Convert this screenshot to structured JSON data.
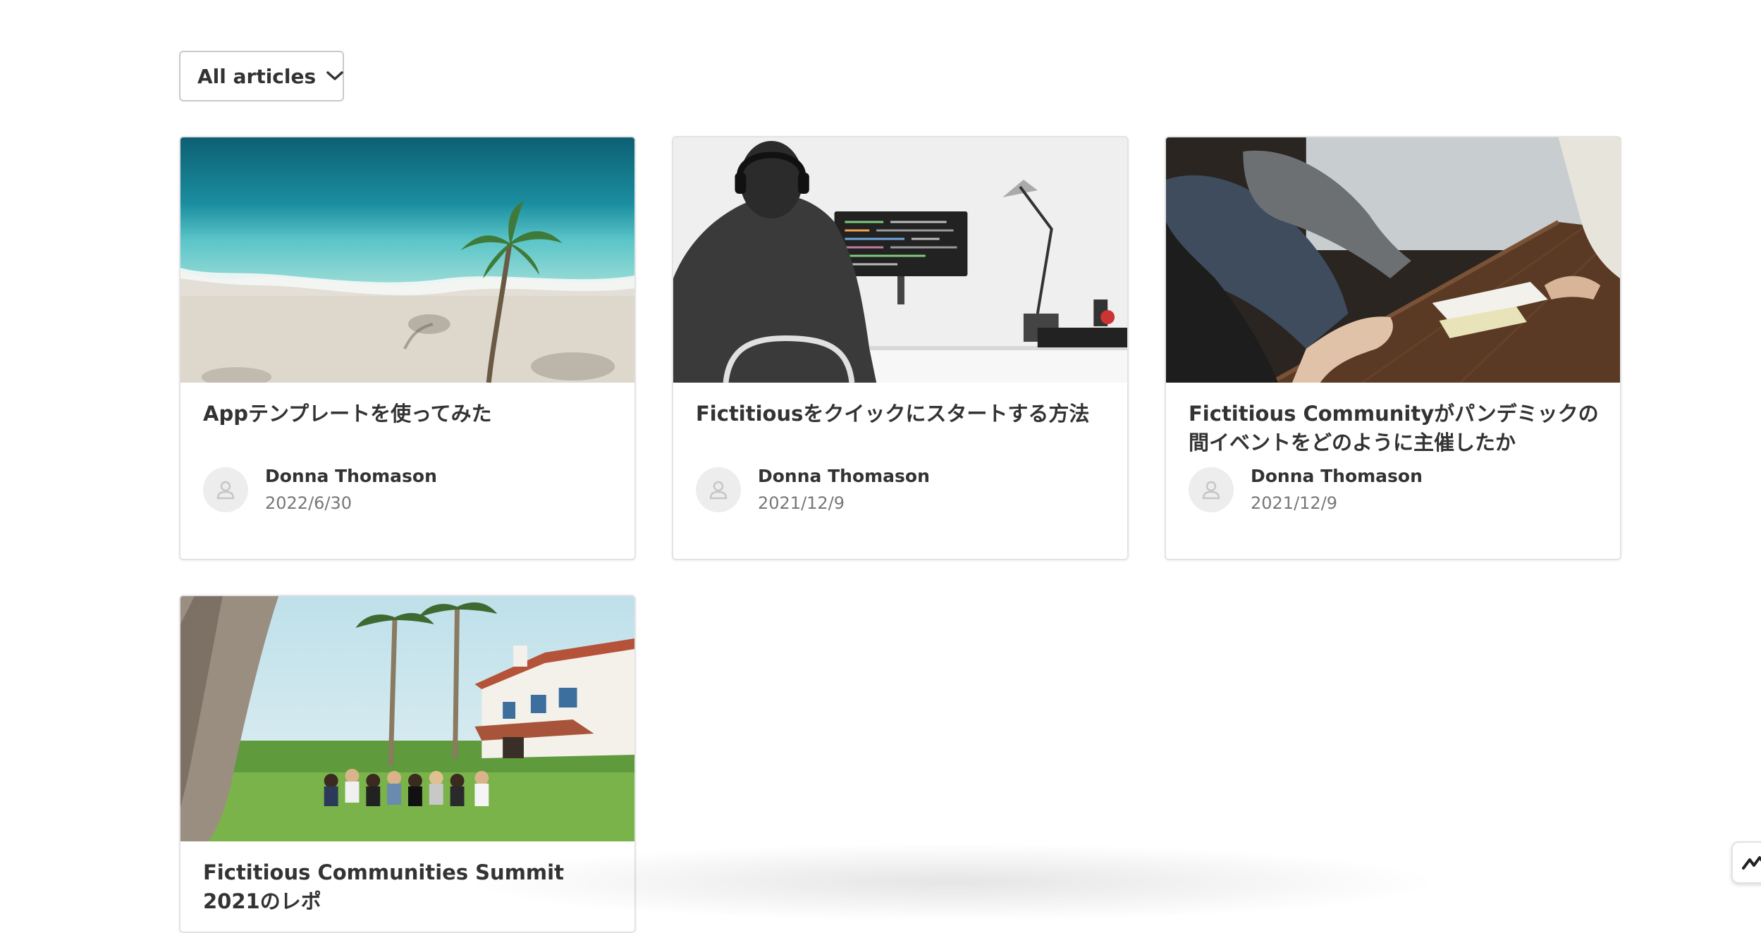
{
  "filter": {
    "label": "All articles",
    "icon": "chevron-down-icon"
  },
  "articles": [
    {
      "title": "Appテンプレートを使ってみた",
      "author": "Donna Thomason",
      "date": "2022/6/30",
      "image": "beach-palm-aerial"
    },
    {
      "title": "Fictitiousをクイックにスタートする方法",
      "author": "Donna Thomason",
      "date": "2021/12/9",
      "image": "developer-at-desk"
    },
    {
      "title": "Fictitious Communityがパンデミックの間イベントをどのように主催したか",
      "author": "Donna Thomason",
      "date": "2021/12/9",
      "image": "meeting-table"
    },
    {
      "title": "Fictitious Communities Summit 2021のレポ",
      "image": "group-on-lawn"
    }
  ],
  "colors": {
    "text": "#333333",
    "muted": "#777777",
    "border": "#e3e3e3",
    "avatar_bg": "#ededed"
  }
}
